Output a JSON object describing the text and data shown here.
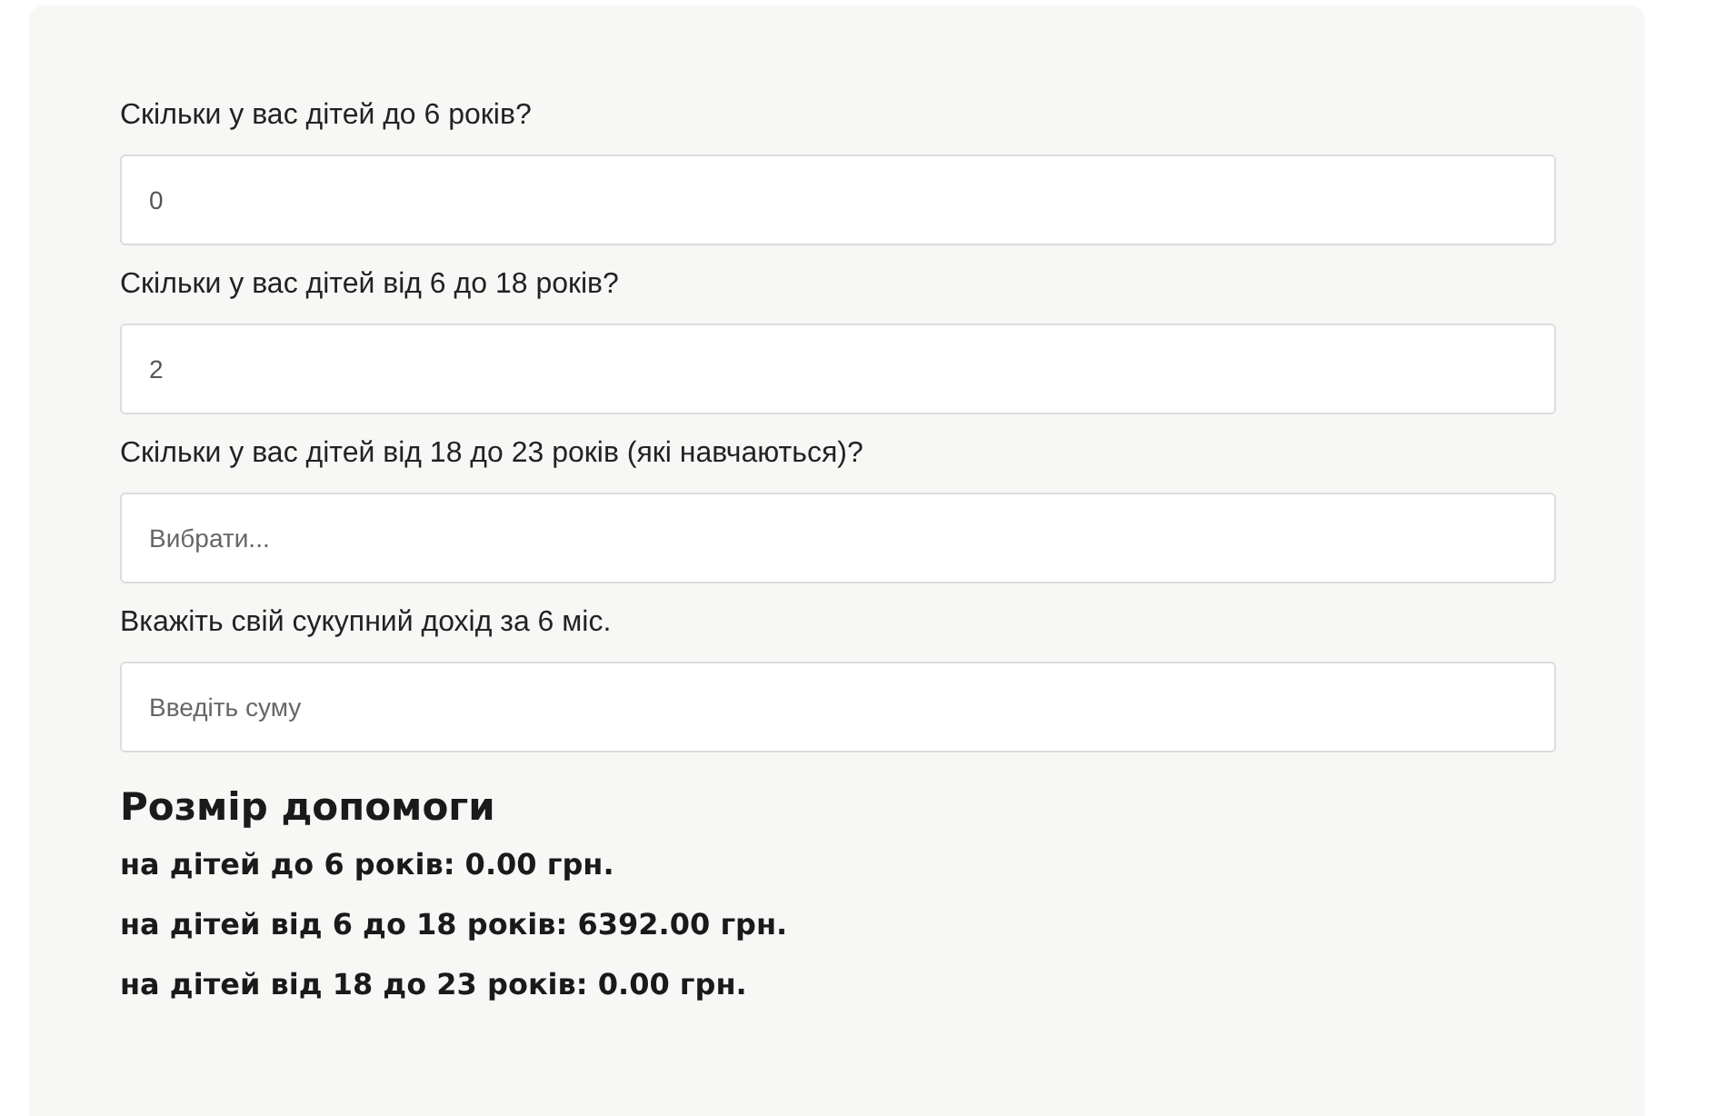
{
  "questions": [
    {
      "label": "Скільки у вас дітей до 6 років?",
      "kind": "number",
      "value": "0"
    },
    {
      "label": "Скільки у вас дітей від 6 до 18 років?",
      "kind": "number",
      "value": "2"
    },
    {
      "label": "Скільки у вас дітей від 18 до 23 років (які навчаються)?",
      "kind": "select",
      "placeholder": "Вибрати..."
    },
    {
      "label": "Вкажіть свій сукупний дохід за 6 міс.",
      "kind": "number",
      "placeholder": "Введіть суму"
    }
  ],
  "result": {
    "title": "Розмір допомоги",
    "lines": [
      "на дітей до 6 років: 0.00 грн.",
      "на дітей від 6 до 18 років: 6392.00 грн.",
      "на дітей від 18 до 23 років: 0.00 грн."
    ]
  }
}
